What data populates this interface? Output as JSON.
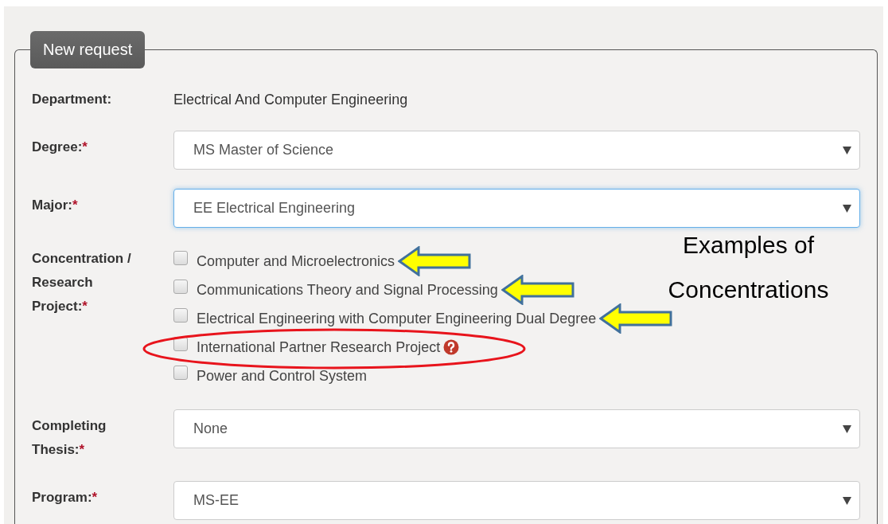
{
  "form": {
    "legend": "New request",
    "fields": [
      {
        "kind": "text",
        "label": "Department:",
        "value": "Electrical And Computer Engineering"
      },
      {
        "kind": "select",
        "label": "Degree:",
        "marker": "*",
        "value": "MS Master of Science",
        "focused": false
      },
      {
        "kind": "select",
        "label": "Major:",
        "marker": "*",
        "value": "EE Electrical Engineering",
        "focused": true
      },
      {
        "kind": "checkboxes",
        "label": "Concentration / Research Project:",
        "marker": "*",
        "options": [
          {
            "label": "Computer and Microelectronics",
            "checked": false,
            "arrow": true,
            "circled": false,
            "help": false
          },
          {
            "label": "Communications Theory and Signal Processing",
            "checked": false,
            "arrow": true,
            "circled": false,
            "help": false
          },
          {
            "label": "Electrical Engineering with Computer Engineering Dual Degree",
            "checked": false,
            "arrow": true,
            "circled": false,
            "help": false
          },
          {
            "label": "International Partner Research Project",
            "checked": false,
            "arrow": false,
            "circled": true,
            "help": true
          },
          {
            "label": "Power and Control System",
            "checked": false,
            "arrow": false,
            "circled": false,
            "help": false
          }
        ]
      },
      {
        "kind": "select",
        "label": "Completing Thesis:",
        "marker": "*",
        "value": "None",
        "focused": false
      },
      {
        "kind": "select",
        "label": "Program:",
        "marker": "*",
        "value": "MS-EE",
        "focused": false
      }
    ]
  },
  "annotation": {
    "lines": [
      "Examples of",
      "Concentrations"
    ]
  }
}
